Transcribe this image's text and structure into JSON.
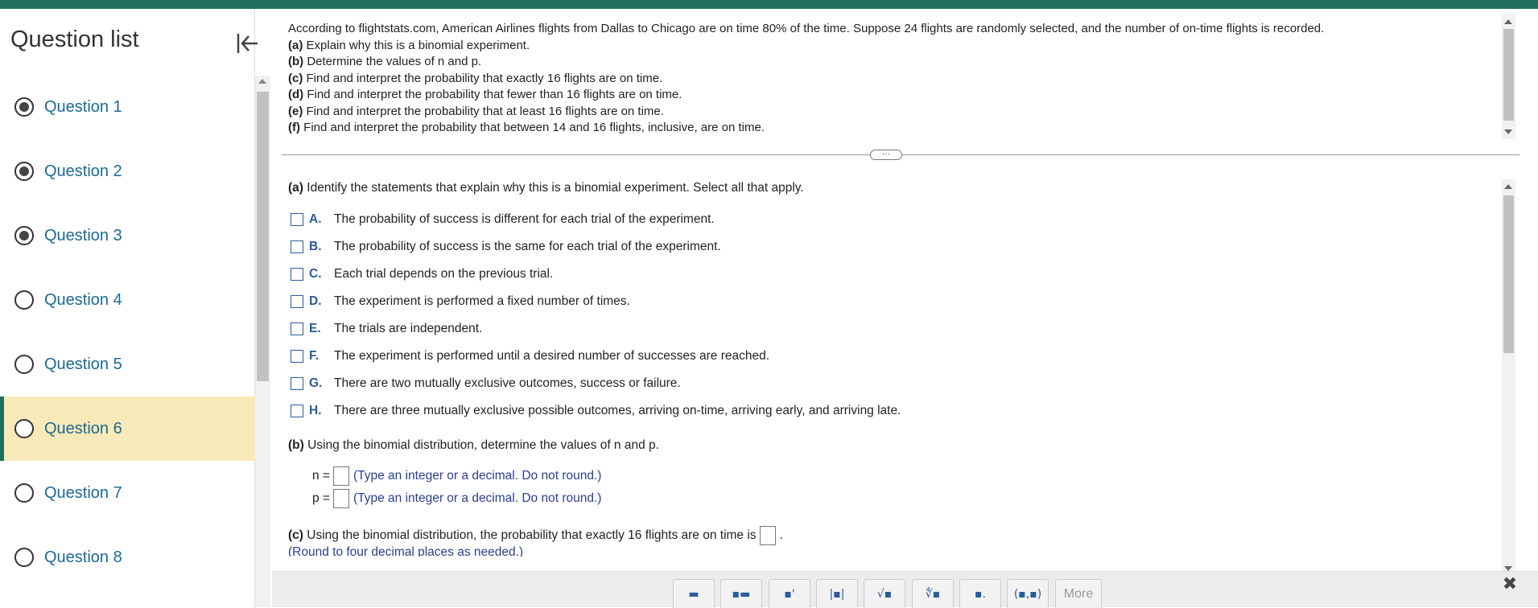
{
  "sidebar": {
    "title": "Question list",
    "items": [
      {
        "label": "Question 1",
        "state": "answered"
      },
      {
        "label": "Question 2",
        "state": "answered"
      },
      {
        "label": "Question 3",
        "state": "answered"
      },
      {
        "label": "Question 4",
        "state": "unanswered"
      },
      {
        "label": "Question 5",
        "state": "unanswered"
      },
      {
        "label": "Question 6",
        "state": "current"
      },
      {
        "label": "Question 7",
        "state": "unanswered"
      },
      {
        "label": "Question 8",
        "state": "unanswered"
      }
    ]
  },
  "stem": {
    "intro": "According to flightstats.com, American Airlines flights from Dallas to Chicago are on time 80% of the time. Suppose 24 flights are randomly selected, and the number of on-time flights is recorded.",
    "parts": [
      {
        "tag": "(a)",
        "text": "Explain why this is a binomial experiment."
      },
      {
        "tag": "(b)",
        "text": "Determine the values of n and p."
      },
      {
        "tag": "(c)",
        "text": "Find and interpret the probability that exactly 16 flights are on time."
      },
      {
        "tag": "(d)",
        "text": "Find and interpret the probability that fewer than 16 flights are on time."
      },
      {
        "tag": "(e)",
        "text": "Find and interpret the probability that at least 16 flights are on time."
      },
      {
        "tag": "(f)",
        "text": "Find and interpret the probability that between 14 and 16 flights, inclusive, are on time."
      }
    ]
  },
  "work": {
    "part_a": {
      "tag": "(a)",
      "prompt": "Identify the statements that explain why this is a binomial experiment. Select all that apply."
    },
    "options": [
      {
        "letter": "A.",
        "text": "The probability of success is different for each trial of the experiment."
      },
      {
        "letter": "B.",
        "text": "The probability of success is the same for each trial of the experiment."
      },
      {
        "letter": "C.",
        "text": "Each trial depends on the previous trial."
      },
      {
        "letter": "D.",
        "text": "The experiment is performed a fixed number of times."
      },
      {
        "letter": "E.",
        "text": "The trials are independent."
      },
      {
        "letter": "F.",
        "text": "The experiment is performed until a desired number of successes are reached."
      },
      {
        "letter": "G.",
        "text": "There are two mutually exclusive outcomes, success or failure."
      },
      {
        "letter": "H.",
        "text": "There are three mutually exclusive possible outcomes, arriving on-time, arriving early, and arriving late."
      }
    ],
    "part_b": {
      "tag": "(b)",
      "prompt": "Using the binomial distribution, determine the values of n and p.",
      "n_label": "n =",
      "p_label": "p =",
      "hint": "(Type an integer or a decimal. Do not round.)"
    },
    "part_c": {
      "tag": "(c)",
      "prompt": "Using the binomial distribution, the probability that exactly 16 flights are on time is",
      "hint": "(Round to four decimal places as needed.)"
    }
  },
  "toolbar": {
    "buttons": [
      {
        "icon": "fraction-icon",
        "glyph": "▬"
      },
      {
        "icon": "mixed-number-icon",
        "glyph": "▪▬"
      },
      {
        "icon": "exponent-icon",
        "glyph": "▪'"
      },
      {
        "icon": "absolute-value-icon",
        "glyph": "|▪|"
      },
      {
        "icon": "square-root-icon",
        "glyph": "√▪"
      },
      {
        "icon": "nth-root-icon",
        "glyph": "∜▪"
      },
      {
        "icon": "decimal-icon",
        "glyph": "▪."
      },
      {
        "icon": "ordered-pair-icon",
        "glyph": "(▪,▪)"
      }
    ],
    "more_label": "More"
  },
  "colors": {
    "accent": "#1f6f5c",
    "link": "#1a6a95",
    "current_row": "#f8e9b8",
    "option_letter": "#2a5c9a"
  }
}
